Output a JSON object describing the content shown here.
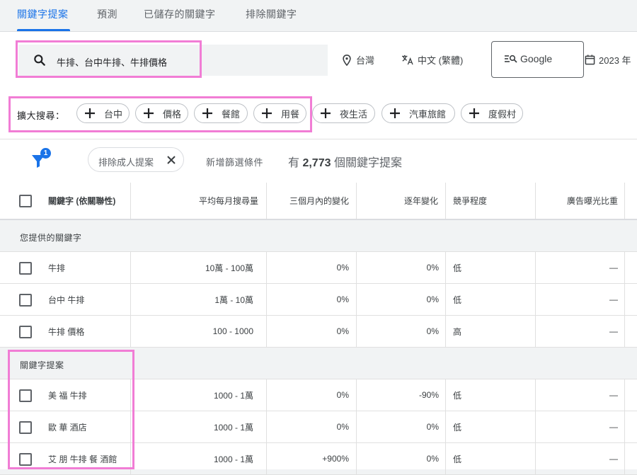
{
  "tabs": [
    {
      "label": "關鍵字提案",
      "active": true
    },
    {
      "label": "預測",
      "active": false
    },
    {
      "label": "已儲存的關鍵字",
      "active": false
    },
    {
      "label": "排除關鍵字",
      "active": false
    }
  ],
  "search": {
    "value": "牛排、台中牛排、牛排價格"
  },
  "location": {
    "label": "台灣"
  },
  "language": {
    "label": "中文 (繁體)"
  },
  "network": {
    "label": "Google"
  },
  "date": {
    "label": "2023 年"
  },
  "expand": {
    "label": "擴大搜尋：",
    "chips": [
      "台中",
      "價格",
      "餐館",
      "用餐",
      "夜生活",
      "汽車旅館",
      "度假村"
    ]
  },
  "filters": {
    "badge_count": "1",
    "adult_chip": "排除成人提案",
    "add_filter": "新增篩選條件",
    "count_prefix": "有 ",
    "count_value": "2,773",
    "count_suffix": " 個關鍵字提案"
  },
  "table": {
    "columns": [
      "關鍵字 (依關聯性)",
      "平均每月搜尋量",
      "三個月內的變化",
      "逐年變化",
      "競爭程度",
      "廣告曝光比重"
    ],
    "group1": "您提供的關鍵字",
    "group2": "關鍵字提案",
    "rows_provided": [
      {
        "keyword": "牛排",
        "volume": "10萬 - 100萬",
        "three_month": "0%",
        "yoy": "0%",
        "competition": "低",
        "share": "—"
      },
      {
        "keyword": "台中 牛排",
        "volume": "1萬 - 10萬",
        "three_month": "0%",
        "yoy": "0%",
        "competition": "低",
        "share": "—"
      },
      {
        "keyword": "牛排 價格",
        "volume": "100 - 1000",
        "three_month": "0%",
        "yoy": "0%",
        "competition": "高",
        "share": "—"
      }
    ],
    "rows_ideas": [
      {
        "keyword": "美 福 牛排",
        "volume": "1000 - 1萬",
        "three_month": "0%",
        "yoy": "-90%",
        "competition": "低",
        "share": "—"
      },
      {
        "keyword": "歐 華 酒店",
        "volume": "1000 - 1萬",
        "three_month": "0%",
        "yoy": "0%",
        "competition": "低",
        "share": "—"
      },
      {
        "keyword": "艾 朋 牛排 餐 酒館",
        "volume": "1000 - 1萬",
        "three_month": "+900%",
        "yoy": "0%",
        "competition": "低",
        "share": "—"
      }
    ]
  },
  "colors": {
    "accent": "#1a73e8",
    "highlight": "#f17dd5"
  }
}
